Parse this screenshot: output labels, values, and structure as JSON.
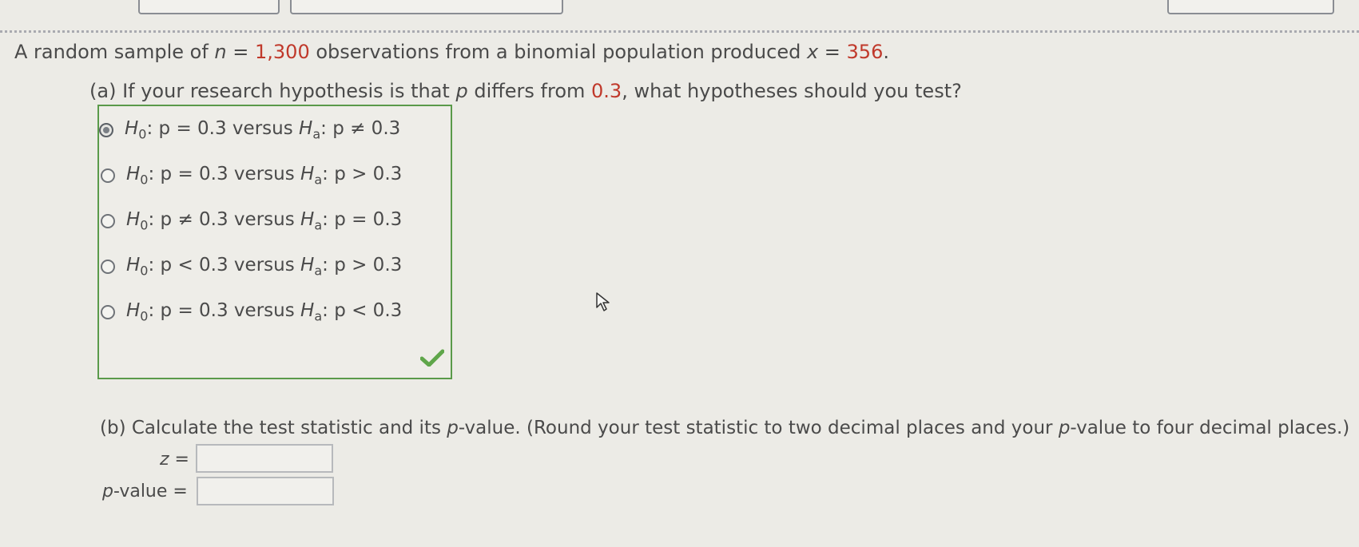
{
  "question": {
    "intro_prefix": "A random sample of ",
    "n_var": "n",
    "eq1": " = ",
    "n_value": "1,300",
    "intro_middle": " observations from a binomial population produced ",
    "x_var": "x",
    "eq2": " = ",
    "x_value": "356",
    "intro_end": "."
  },
  "part_a": {
    "prefix": "(a) If your research hypothesis is that ",
    "p_var": "p",
    "middle": " differs from ",
    "value": "0.3",
    "suffix": ", what hypotheses should you test?",
    "options": [
      {
        "h0": "p = 0.3",
        "ha": "p ≠ 0.3",
        "selected": true
      },
      {
        "h0": "p = 0.3",
        "ha": "p > 0.3",
        "selected": false
      },
      {
        "h0": "p ≠ 0.3",
        "ha": "p = 0.3",
        "selected": false
      },
      {
        "h0": "p < 0.3",
        "ha": "p > 0.3",
        "selected": false
      },
      {
        "h0": "p = 0.3",
        "ha": "p < 0.3",
        "selected": false
      }
    ],
    "h_letter": "H",
    "h0_sub": "0",
    "ha_sub": "a",
    "colon": ": ",
    "versus": " versus ",
    "status_icon": "checkmark-icon",
    "status_color": "#5fa64a"
  },
  "part_b": {
    "prefix": "(b) Calculate the test statistic and its ",
    "p_var": "p",
    "middle": "-value. (Round your test statistic to two decimal places and your ",
    "p_var2": "p",
    "suffix": "-value to four decimal places.)",
    "z_label": "z =",
    "z_value": "",
    "pvalue_var": "p",
    "pvalue_label": "-value =",
    "pvalue_value": ""
  },
  "colors": {
    "accent": "#c0392b",
    "correct": "#5fa64a"
  }
}
